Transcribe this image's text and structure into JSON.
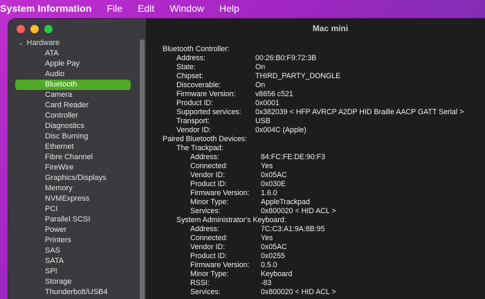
{
  "menubar": {
    "app_name": "System Information",
    "items": [
      "File",
      "Edit",
      "Window",
      "Help"
    ]
  },
  "window": {
    "title": "Mac mini"
  },
  "sidebar": {
    "group_label": "Hardware",
    "items": [
      "ATA",
      "Apple Pay",
      "Audio",
      "Bluetooth",
      "Camera",
      "Card Reader",
      "Controller",
      "Diagnostics",
      "Disc Burning",
      "Ethernet",
      "Fibre Channel",
      "FireWire",
      "Graphics/Displays",
      "Memory",
      "NVMExpress",
      "PCI",
      "Parallel SCSI",
      "Power",
      "Printers",
      "SAS",
      "SATA",
      "SPI",
      "Storage",
      "Thunderbolt/USB4"
    ],
    "selected": "Bluetooth"
  },
  "details": {
    "controller_header": "Bluetooth Controller:",
    "controller": [
      {
        "k": "Address:",
        "v": "00:26:B0:F9:72:3B"
      },
      {
        "k": "State:",
        "v": "On"
      },
      {
        "k": "Chipset:",
        "v": "THIRD_PARTY_DONGLE"
      },
      {
        "k": "Discoverable:",
        "v": "On"
      },
      {
        "k": "Firmware Version:",
        "v": "v8656 c521"
      },
      {
        "k": "Product ID:",
        "v": "0x0001"
      },
      {
        "k": "Supported services:",
        "v": "0x382039 < HFP AVRCP A2DP HID Braille AACP GATT Serial >"
      },
      {
        "k": "Transport:",
        "v": "USB"
      },
      {
        "k": "Vendor ID:",
        "v": "0x004C (Apple)"
      }
    ],
    "paired_header": "Paired Bluetooth Devices:",
    "devices": [
      {
        "name": "The Trackpad:",
        "props": [
          {
            "k": "Address:",
            "v": "84:FC:FE:DE:90:F3"
          },
          {
            "k": "Connected:",
            "v": "Yes"
          },
          {
            "k": "Vendor ID:",
            "v": "0x05AC"
          },
          {
            "k": "Product ID:",
            "v": "0x030E"
          },
          {
            "k": "Firmware Version:",
            "v": "1.6.0"
          },
          {
            "k": "Minor Type:",
            "v": "AppleTrackpad"
          },
          {
            "k": "Services:",
            "v": "0x800020 < HID ACL >"
          }
        ]
      },
      {
        "name": "System Administrator's Keyboard:",
        "props": [
          {
            "k": "Address:",
            "v": "7C:C3:A1:9A:8B:95"
          },
          {
            "k": "Connected:",
            "v": "Yes"
          },
          {
            "k": "Vendor ID:",
            "v": "0x05AC"
          },
          {
            "k": "Product ID:",
            "v": "0x0255"
          },
          {
            "k": "Firmware Version:",
            "v": "0.5.0"
          },
          {
            "k": "Minor Type:",
            "v": "Keyboard"
          },
          {
            "k": "RSSI:",
            "v": "-83"
          },
          {
            "k": "Services:",
            "v": "0x800020 < HID ACL >"
          }
        ]
      }
    ]
  },
  "colors": {
    "selection": "#52a828",
    "close": "#fe5f57",
    "minimize": "#febc2e",
    "maximize": "#28c840"
  }
}
